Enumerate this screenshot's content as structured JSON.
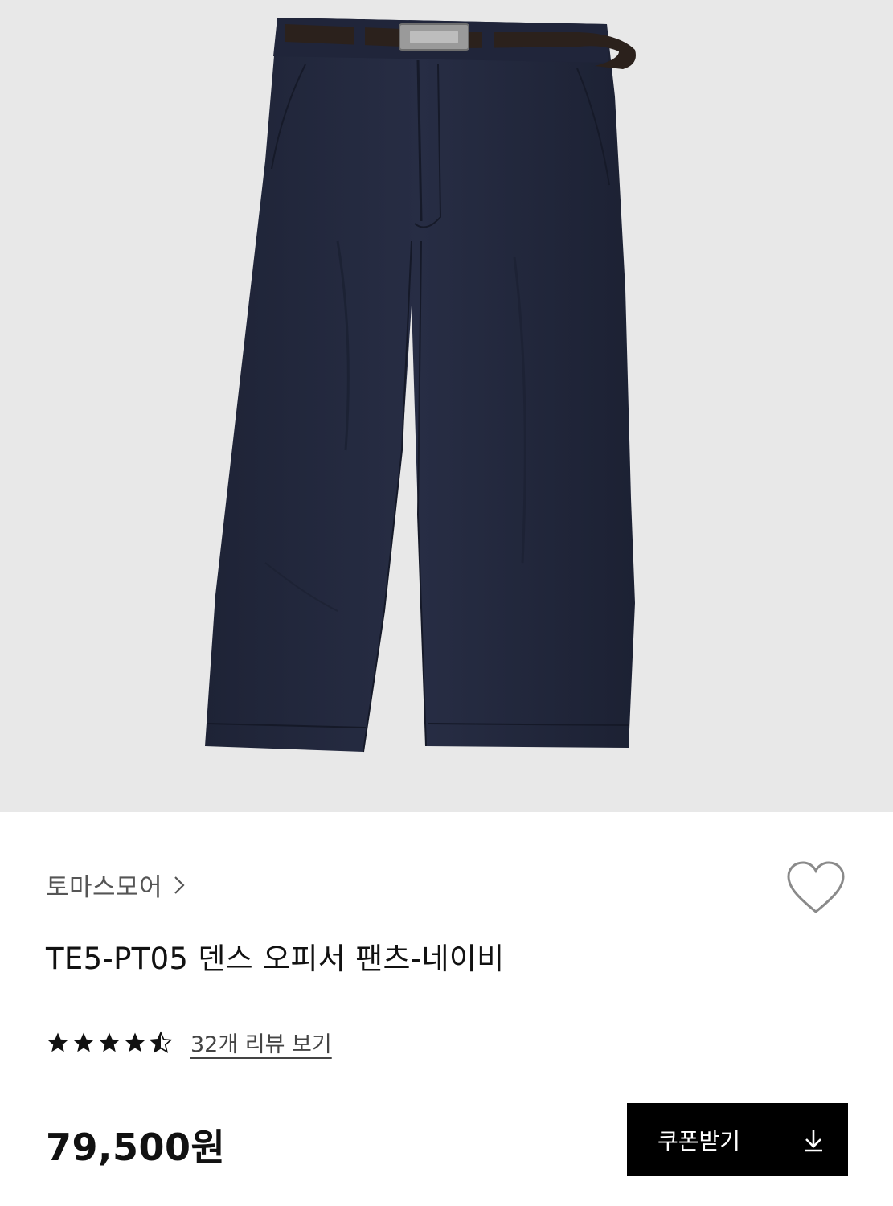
{
  "product": {
    "image_alt": "navy wide office pants with brown belt",
    "brand": "토마스모어",
    "title": "TE5-PT05 덴스 오피서 팬츠-네이비",
    "rating": 4.5,
    "rating_max": 5,
    "review_link_label": "32개 리뷰 보기",
    "price": "79,500원",
    "coupon_button_label": "쿠폰받기"
  },
  "icons": {
    "brand_chevron": "chevron-right-icon",
    "wishlist": "heart-outline-icon",
    "rating": "star-icon",
    "coupon_download": "download-icon"
  },
  "colors": {
    "image_background": "#e8e8e8",
    "pants": "#23283d",
    "belt": "#2b211c",
    "button_background": "#000000",
    "button_text": "#ffffff",
    "brand_text": "#555555"
  }
}
